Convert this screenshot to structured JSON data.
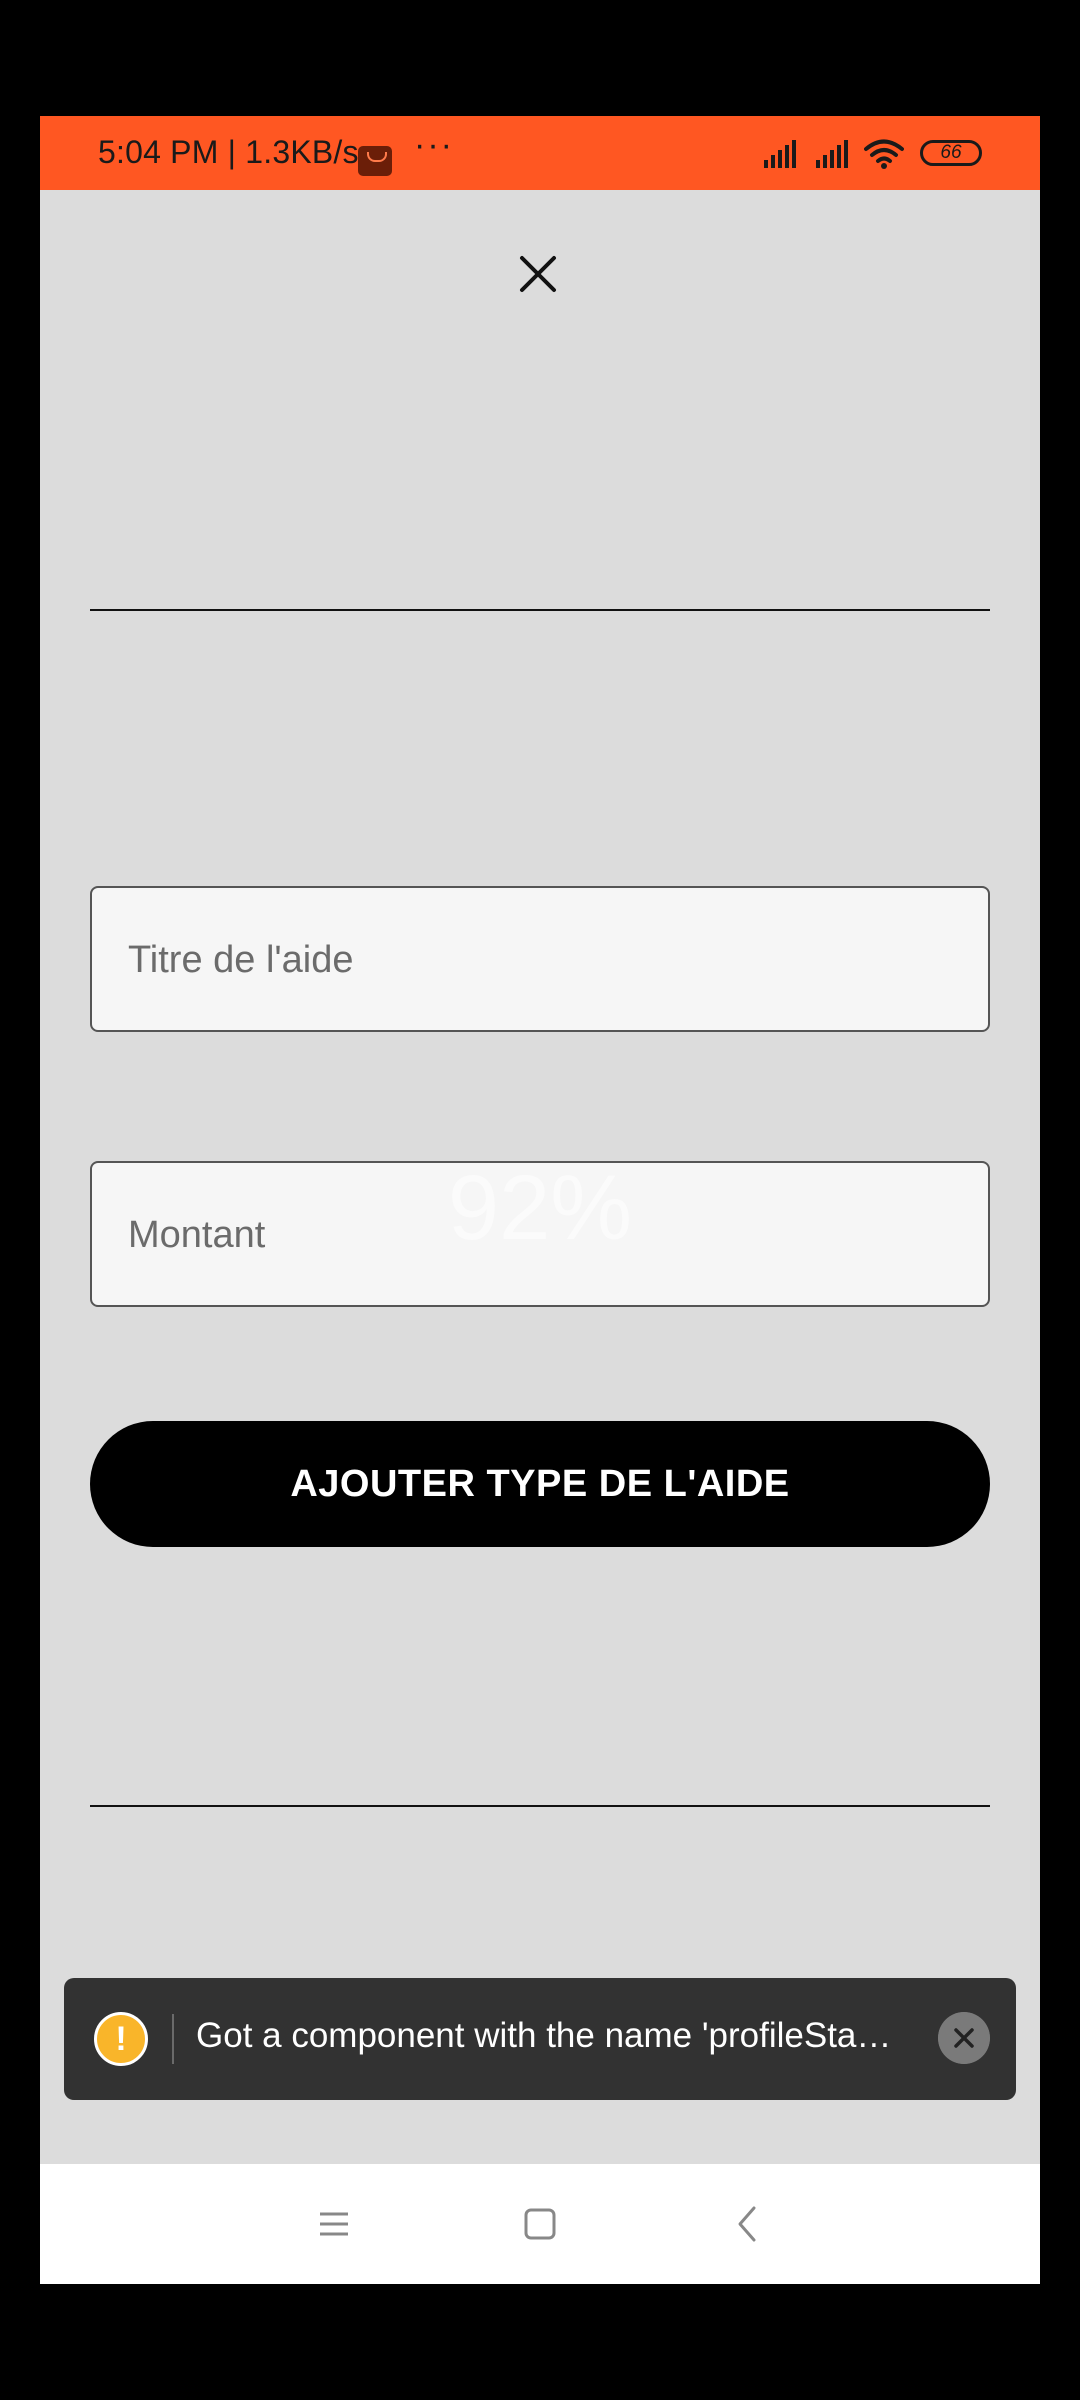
{
  "status_bar": {
    "time_speed": "5:04 PM | 1.3KB/s",
    "more": "···",
    "battery": "66"
  },
  "form": {
    "title_placeholder": "Titre de l'aide",
    "amount_placeholder": "Montant",
    "submit_label": "AJOUTER TYPE DE L'AIDE"
  },
  "overlay": {
    "progress_text": "92%"
  },
  "toast": {
    "message": "Got a component with the name 'profileSta…"
  },
  "colors": {
    "status_bar": "#ff5722",
    "background": "#dcdcdc",
    "button": "#000000",
    "toast": "#323232",
    "warning": "#f9b52a"
  },
  "icons": {
    "close": "close-icon",
    "warning": "warning-icon",
    "toast_close": "close-circle-icon",
    "nav_menu": "menu-icon",
    "nav_home": "home-icon",
    "nav_back": "back-icon"
  }
}
